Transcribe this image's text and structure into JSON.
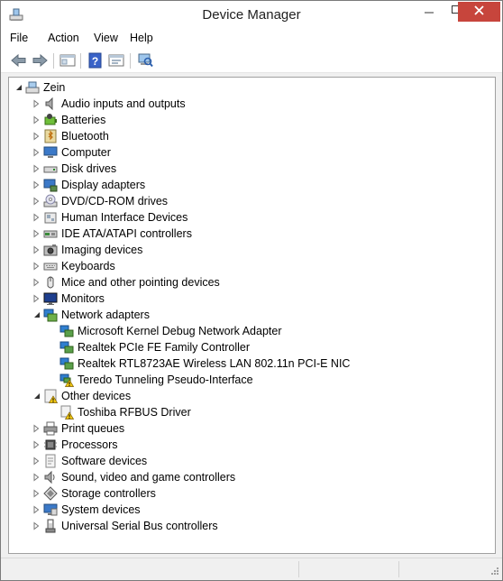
{
  "window": {
    "title": "Device Manager"
  },
  "menu": [
    {
      "id": "file",
      "label": "File"
    },
    {
      "id": "action",
      "label": "Action"
    },
    {
      "id": "view",
      "label": "View"
    },
    {
      "id": "help",
      "label": "Help"
    }
  ],
  "toolbar": [
    {
      "id": "back",
      "icon": "back-arrow-icon"
    },
    {
      "id": "forward",
      "icon": "forward-arrow-icon"
    },
    {
      "id": "show-hide-console-tree",
      "icon": "console-tree-icon"
    },
    {
      "id": "help",
      "icon": "help-icon"
    },
    {
      "id": "properties",
      "icon": "properties-icon"
    },
    {
      "id": "scan-hardware",
      "icon": "scan-hardware-icon"
    }
  ],
  "tree": {
    "root": {
      "label": "Zein",
      "icon": "computer-root-icon",
      "expanded": true
    },
    "categories": [
      {
        "label": "Audio inputs and outputs",
        "icon": "speaker-icon",
        "expanded": false
      },
      {
        "label": "Batteries",
        "icon": "battery-icon",
        "expanded": false
      },
      {
        "label": "Bluetooth",
        "icon": "bluetooth-icon",
        "expanded": false
      },
      {
        "label": "Computer",
        "icon": "computer-icon",
        "expanded": false
      },
      {
        "label": "Disk drives",
        "icon": "disk-drive-icon",
        "expanded": false
      },
      {
        "label": "Display adapters",
        "icon": "display-adapter-icon",
        "expanded": false
      },
      {
        "label": "DVD/CD-ROM drives",
        "icon": "dvd-drive-icon",
        "expanded": false
      },
      {
        "label": "Human Interface Devices",
        "icon": "hid-icon",
        "expanded": false
      },
      {
        "label": "IDE ATA/ATAPI controllers",
        "icon": "ide-controller-icon",
        "expanded": false
      },
      {
        "label": "Imaging devices",
        "icon": "camera-icon",
        "expanded": false
      },
      {
        "label": "Keyboards",
        "icon": "keyboard-icon",
        "expanded": false
      },
      {
        "label": "Mice and other pointing devices",
        "icon": "mouse-icon",
        "expanded": false
      },
      {
        "label": "Monitors",
        "icon": "monitor-icon",
        "expanded": false
      },
      {
        "label": "Network adapters",
        "icon": "network-icon",
        "expanded": true,
        "children": [
          {
            "label": "Microsoft Kernel Debug Network Adapter",
            "icon": "network-adapter-icon",
            "warning": false
          },
          {
            "label": "Realtek PCIe FE Family Controller",
            "icon": "network-adapter-icon",
            "warning": false
          },
          {
            "label": "Realtek RTL8723AE Wireless LAN 802.11n PCI-E NIC",
            "icon": "network-adapter-icon",
            "warning": false
          },
          {
            "label": "Teredo Tunneling Pseudo-Interface",
            "icon": "network-adapter-warning-icon",
            "warning": true
          }
        ]
      },
      {
        "label": "Other devices",
        "icon": "other-devices-icon",
        "expanded": true,
        "children": [
          {
            "label": "Toshiba RFBUS Driver",
            "icon": "unknown-device-warning-icon",
            "warning": true
          }
        ]
      },
      {
        "label": "Print queues",
        "icon": "printer-icon",
        "expanded": false
      },
      {
        "label": "Processors",
        "icon": "processor-icon",
        "expanded": false
      },
      {
        "label": "Software devices",
        "icon": "software-device-icon",
        "expanded": false
      },
      {
        "label": "Sound, video and game controllers",
        "icon": "sound-controller-icon",
        "expanded": false
      },
      {
        "label": "Storage controllers",
        "icon": "storage-controller-icon",
        "expanded": false
      },
      {
        "label": "System devices",
        "icon": "system-device-icon",
        "expanded": false
      },
      {
        "label": "Universal Serial Bus controllers",
        "icon": "usb-icon",
        "expanded": false
      }
    ]
  },
  "colors": {
    "close": "#c7453c",
    "warning": "#f2c811",
    "network": "#2f7fd0"
  }
}
